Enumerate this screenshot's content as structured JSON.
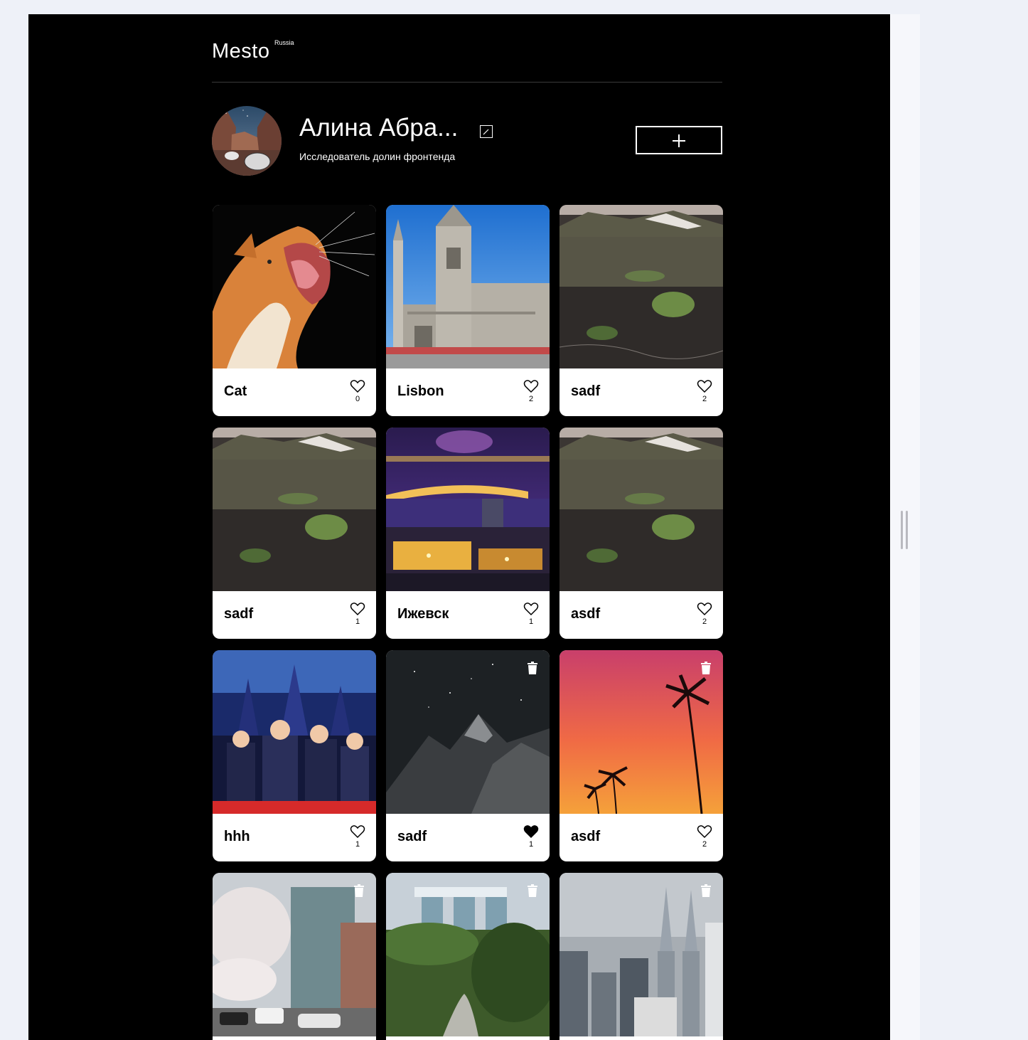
{
  "header": {
    "logo": "Mesto",
    "logo_superscript": "Russia"
  },
  "profile": {
    "name": "Алина Абра...",
    "about": "Исследователь долин фронтенда"
  },
  "cards": [
    {
      "title": "Cat",
      "likes": "0",
      "liked": false,
      "deletable": false,
      "image": "cat"
    },
    {
      "title": "Lisbon",
      "likes": "2",
      "liked": false,
      "deletable": false,
      "image": "cathedral"
    },
    {
      "title": "sadf",
      "likes": "2",
      "liked": false,
      "deletable": false,
      "image": "meadow"
    },
    {
      "title": "sadf",
      "likes": "1",
      "liked": false,
      "deletable": false,
      "image": "meadow"
    },
    {
      "title": "Ижевск",
      "likes": "1",
      "liked": false,
      "deletable": false,
      "image": "night-city"
    },
    {
      "title": "asdf",
      "likes": "2",
      "liked": false,
      "deletable": false,
      "image": "meadow"
    },
    {
      "title": "hhh",
      "likes": "1",
      "liked": false,
      "deletable": false,
      "image": "anime"
    },
    {
      "title": "sadf",
      "likes": "1",
      "liked": true,
      "deletable": true,
      "image": "mountain-night"
    },
    {
      "title": "asdf",
      "likes": "2",
      "liked": false,
      "deletable": true,
      "image": "palm-sunset"
    },
    {
      "title": "",
      "likes": "",
      "liked": false,
      "deletable": true,
      "image": "street"
    },
    {
      "title": "",
      "likes": "",
      "liked": false,
      "deletable": true,
      "image": "garden"
    },
    {
      "title": "",
      "likes": "",
      "liked": false,
      "deletable": true,
      "image": "towers"
    }
  ],
  "colors": {
    "page_background": "#000000",
    "card_background": "#ffffff",
    "outer_background": "#eef1f8"
  },
  "icons": {
    "edit": "pencil-icon",
    "add": "plus-icon",
    "like": "heart-icon",
    "delete": "trash-icon"
  }
}
